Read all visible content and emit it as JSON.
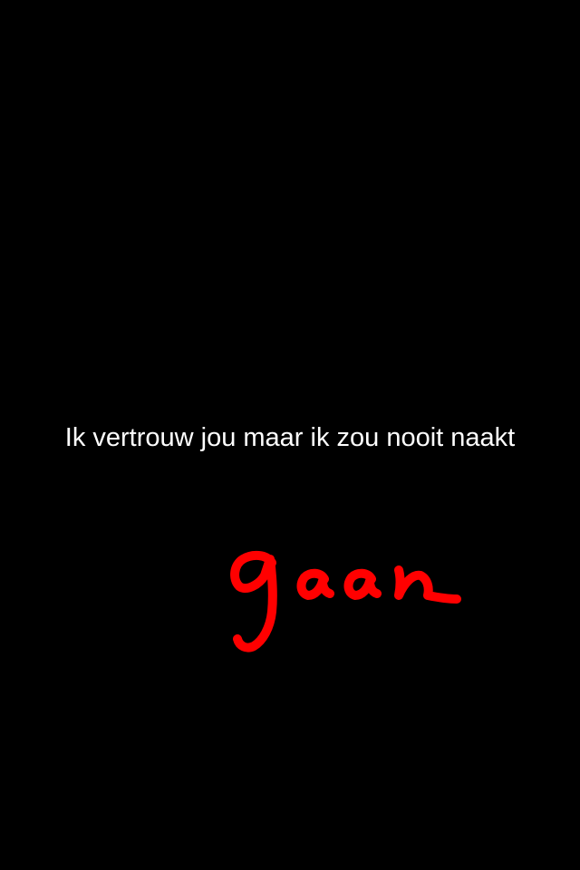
{
  "background_color": "#000000",
  "caption": {
    "text": "Ik vertrouw jou maar ik zou nooit naakt",
    "color": "#ffffff"
  },
  "drawing": {
    "text": "gaan",
    "color": "#ff0000",
    "style": "handwritten"
  }
}
